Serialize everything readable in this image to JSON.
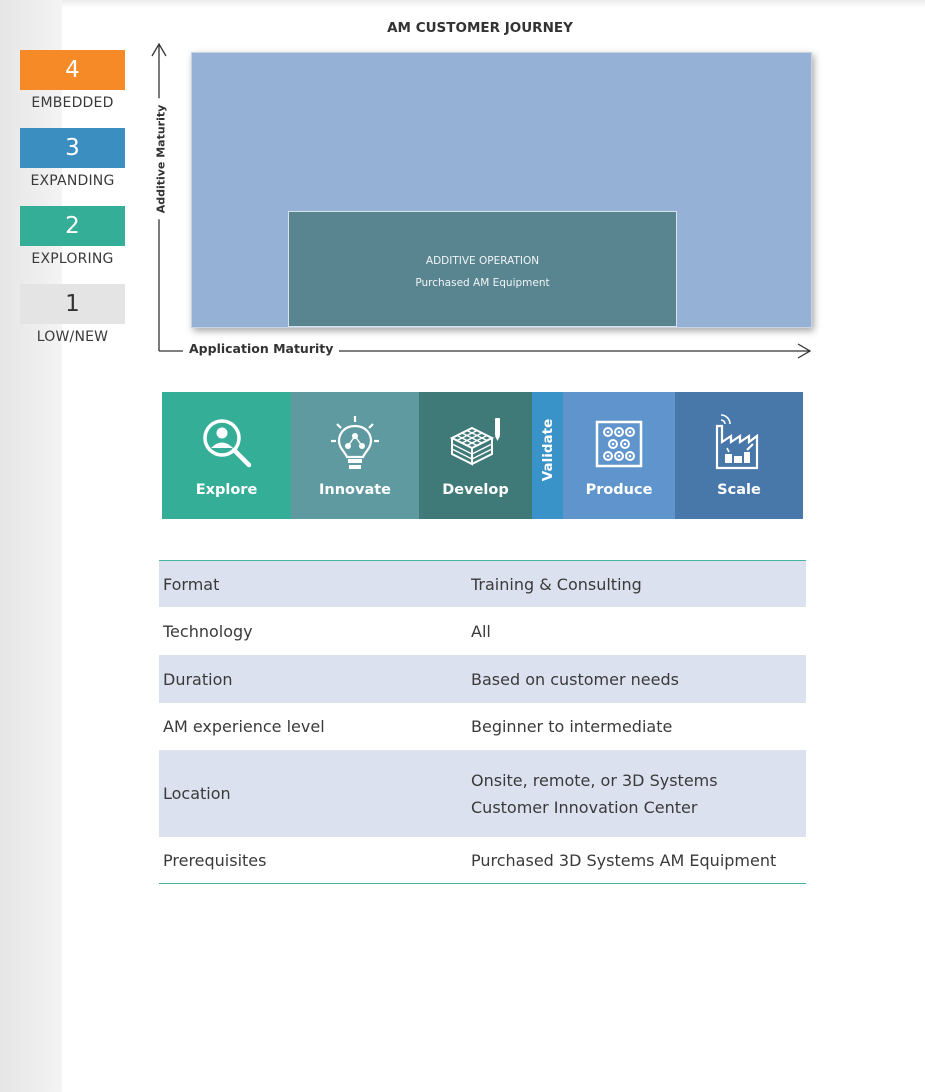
{
  "title": "AM CUSTOMER JOURNEY",
  "levels": [
    {
      "number": "4",
      "label": "EMBEDDED",
      "color": "#f58a27"
    },
    {
      "number": "3",
      "label": "EXPANDING",
      "color": "#3a8fc0"
    },
    {
      "number": "2",
      "label": "EXPLORING",
      "color": "#34ae97"
    },
    {
      "number": "1",
      "label": "LOW/NEW",
      "color": "#e4e4e4"
    }
  ],
  "axes": {
    "y_label": "Additive Maturity",
    "x_label": "Application Maturity"
  },
  "diagram": {
    "outer_color": "#95b2d6",
    "inner_color": "#588590",
    "inner_title": "ADDITIVE OPERATION",
    "inner_subtitle": "Purchased AM Equipment"
  },
  "stages": [
    {
      "label": "Explore",
      "icon": "magnifier-person-icon",
      "color": "#34ae97"
    },
    {
      "label": "Innovate",
      "icon": "lightbulb-network-icon",
      "color": "#5f9aa1"
    },
    {
      "label": "Develop",
      "icon": "lattice-cube-pencil-icon",
      "color": "#407a78"
    },
    {
      "label": "Validate",
      "icon": "",
      "color": "#3a93c8"
    },
    {
      "label": "Produce",
      "icon": "gears-grid-icon",
      "color": "#5f95cc"
    },
    {
      "label": "Scale",
      "icon": "factory-signal-icon",
      "color": "#4877a9"
    }
  ],
  "table": {
    "rows": [
      {
        "key": "Format",
        "value": "Training & Consulting"
      },
      {
        "key": "Technology",
        "value": "All"
      },
      {
        "key": "Duration",
        "value": "Based on customer needs"
      },
      {
        "key": "AM experience level",
        "value": "Beginner to intermediate"
      },
      {
        "key": "Location",
        "value": "Onsite, remote, or 3D Systems Customer Innovation Center"
      },
      {
        "key": "Prerequisites",
        "value": "Purchased 3D Systems AM Equipment"
      }
    ]
  }
}
